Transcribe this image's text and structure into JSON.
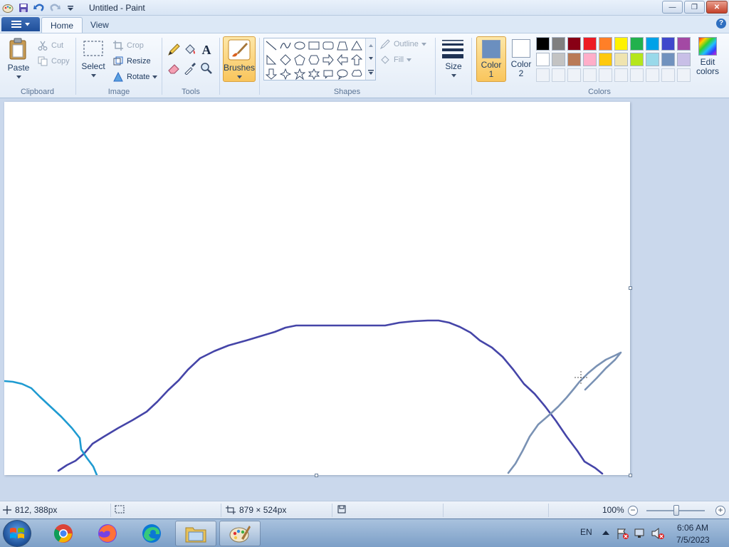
{
  "window": {
    "title": "Untitled - Paint",
    "qat_icons": [
      "paint-app-icon",
      "save-icon",
      "undo-icon",
      "redo-icon",
      "customize-qat-icon"
    ],
    "controls": {
      "minimize": "—",
      "maximize": "❐",
      "close": "✕"
    }
  },
  "tabs": [
    {
      "label": "Home",
      "active": true
    },
    {
      "label": "View",
      "active": false
    }
  ],
  "help_label": "?",
  "ribbon": {
    "clipboard": {
      "label": "Clipboard",
      "paste": "Paste",
      "cut": "Cut",
      "copy": "Copy"
    },
    "image": {
      "label": "Image",
      "select": "Select",
      "crop": "Crop",
      "resize": "Resize",
      "rotate": "Rotate"
    },
    "tools": {
      "label": "Tools",
      "text_glyph": "A"
    },
    "brushes": {
      "label": "Brushes"
    },
    "shapes": {
      "label": "Shapes",
      "outline": "Outline",
      "fill": "Fill"
    },
    "size": {
      "label": "Size"
    },
    "colors": {
      "label": "Colors",
      "color1_label": "Color 1",
      "color1_line1": "Color",
      "color1_line2": "1",
      "color2_line1": "Color",
      "color2_line2": "2",
      "color1_value": "#6b8fbf",
      "color2_value": "#ffffff",
      "edit_line1": "Edit",
      "edit_line2": "colors",
      "palette_row1": [
        "#000000",
        "#7f7f7f",
        "#880015",
        "#ed1c24",
        "#ff7f27",
        "#fff200",
        "#22b14c",
        "#00a2e8",
        "#3f48cc",
        "#a349a4"
      ],
      "palette_row2": [
        "#ffffff",
        "#c3c3c3",
        "#b97a57",
        "#ffaec9",
        "#ffc90e",
        "#efe4b0",
        "#b5e61d",
        "#99d9ea",
        "#7092be",
        "#c8bfe7"
      ]
    }
  },
  "canvas": {
    "strokes": [
      {
        "name": "curve-stroke-navy",
        "color": "#4545a8"
      },
      {
        "name": "curve-stroke-cyan",
        "color": "#1f9bd1"
      },
      {
        "name": "curve-stroke-steel",
        "color": "#7a92b4"
      }
    ]
  },
  "status": {
    "cursor_pos": "812, 388px",
    "selection_size": "",
    "canvas_size": "879 × 524px",
    "zoom": "100%",
    "zoom_out": "−",
    "zoom_in": "+"
  },
  "taskbar": {
    "apps": [
      "chrome-icon",
      "firefox-icon",
      "edge-icon",
      "file-explorer-icon",
      "paint-icon"
    ],
    "language": "EN",
    "time": "6:06 AM",
    "date": "7/5/2023"
  }
}
